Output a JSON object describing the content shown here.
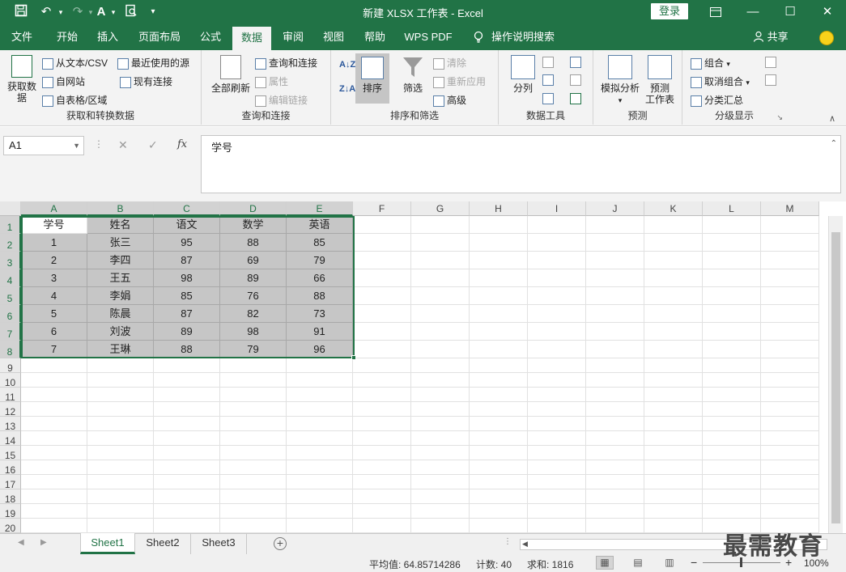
{
  "titlebar": {
    "title": "新建 XLSX 工作表  -  Excel",
    "login": "登录"
  },
  "menu": {
    "tabs": [
      "文件",
      "开始",
      "插入",
      "页面布局",
      "公式",
      "数据",
      "审阅",
      "视图",
      "帮助",
      "WPS PDF"
    ],
    "active_tab": "数据",
    "search": "操作说明搜索",
    "share": "共享"
  },
  "ribbon": {
    "get_data": {
      "big": "获取数据",
      "from_text": "从文本/CSV",
      "from_web": "自网站",
      "from_table": "自表格/区域",
      "recent": "最近使用的源",
      "existing": "现有连接",
      "group_label": "获取和转换数据"
    },
    "queries": {
      "refresh_all": "全部刷新",
      "queries_conn": "查询和连接",
      "properties": "属性",
      "edit_links": "编辑链接",
      "group_label": "查询和连接"
    },
    "sort": {
      "sort": "排序",
      "filter": "筛选",
      "clear": "清除",
      "reapply": "重新应用",
      "advanced": "高级",
      "group_label": "排序和筛选"
    },
    "tools": {
      "split": "分列",
      "group_label": "数据工具"
    },
    "forecast": {
      "whatif": "模拟分析",
      "sheet": "预测",
      "sheet2": "工作表",
      "group_label": "预测"
    },
    "outline": {
      "group": "组合",
      "ungroup": "取消组合",
      "subtotal": "分类汇总",
      "group_label": "分级显示"
    }
  },
  "formula_bar": {
    "name_box": "A1",
    "fx": "fx",
    "content": "学号"
  },
  "columns": [
    "A",
    "B",
    "C",
    "D",
    "E",
    "F",
    "G",
    "H",
    "I",
    "J",
    "K",
    "L",
    "M"
  ],
  "rows": [
    "1",
    "2",
    "3",
    "4",
    "5",
    "6",
    "7",
    "8",
    "9",
    "10",
    "11",
    "12",
    "13",
    "14",
    "15",
    "16",
    "17",
    "18",
    "19",
    "20"
  ],
  "table": {
    "headers": [
      "学号",
      "姓名",
      "语文",
      "数学",
      "英语"
    ],
    "data": [
      [
        "1",
        "张三",
        "95",
        "88",
        "85"
      ],
      [
        "2",
        "李四",
        "87",
        "69",
        "79"
      ],
      [
        "3",
        "王五",
        "98",
        "89",
        "66"
      ],
      [
        "4",
        "李娟",
        "85",
        "76",
        "88"
      ],
      [
        "5",
        "陈晨",
        "87",
        "82",
        "73"
      ],
      [
        "6",
        "刘波",
        "89",
        "98",
        "91"
      ],
      [
        "7",
        "王琳",
        "88",
        "79",
        "96"
      ]
    ]
  },
  "sheets": [
    "Sheet1",
    "Sheet2",
    "Sheet3"
  ],
  "active_sheet": "Sheet1",
  "status": {
    "average": "平均值: 64.85714286",
    "count": "计数: 40",
    "sum": "求和: 1816",
    "zoom": "100%"
  },
  "watermark": "最需教育",
  "colors": {
    "accent": "#217346",
    "selection_fill": "#c6c6c6"
  }
}
